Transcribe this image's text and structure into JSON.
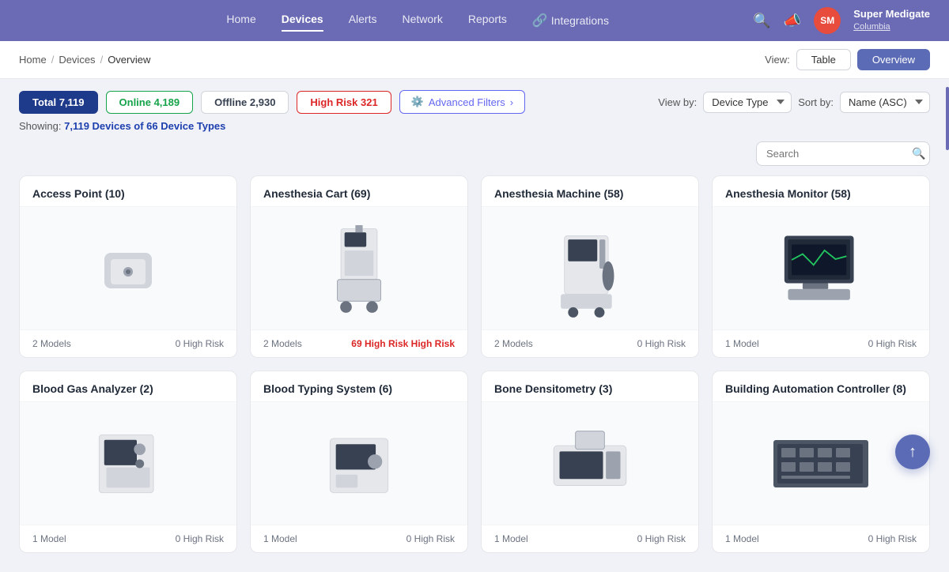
{
  "nav": {
    "links": [
      {
        "label": "Home",
        "active": false
      },
      {
        "label": "Devices",
        "active": true
      },
      {
        "label": "Alerts",
        "active": false
      },
      {
        "label": "Network",
        "active": false
      },
      {
        "label": "Reports",
        "active": false
      },
      {
        "label": "Integrations",
        "active": false
      }
    ],
    "user": {
      "name": "Super Medigate",
      "org": "Columbia",
      "initials": "SM"
    }
  },
  "breadcrumb": {
    "home": "Home",
    "devices": "Devices",
    "current": "Overview"
  },
  "view": {
    "label": "View:",
    "table_label": "Table",
    "overview_label": "Overview",
    "active": "Overview"
  },
  "filters": {
    "total_label": "Total 7,119",
    "online_label": "Online 4,189",
    "offline_label": "Offline 2,930",
    "high_risk_label": "High Risk 321",
    "adv_filters_label": "Advanced Filters",
    "viewby_label": "View by:",
    "viewby_option": "Device Type",
    "sortby_label": "Sort by:",
    "sortby_option": "Name (ASC)"
  },
  "showing": {
    "prefix": "Showing:",
    "highlight": "7,119 Devices of 66 Device Types"
  },
  "search": {
    "placeholder": "Search"
  },
  "devices": [
    {
      "name": "Access Point (10)",
      "models": "2 Models",
      "high_risk": "0 High Risk",
      "high_risk_count": 0,
      "image_type": "access_point"
    },
    {
      "name": "Anesthesia Cart (69)",
      "models": "2 Models",
      "high_risk": "69 High Risk",
      "high_risk_count": 69,
      "image_type": "anesthesia_cart"
    },
    {
      "name": "Anesthesia Machine (58)",
      "models": "2 Models",
      "high_risk": "0 High Risk",
      "high_risk_count": 0,
      "image_type": "anesthesia_machine"
    },
    {
      "name": "Anesthesia Monitor (58)",
      "models": "1 Model",
      "high_risk": "0 High Risk",
      "high_risk_count": 0,
      "image_type": "anesthesia_monitor"
    },
    {
      "name": "Blood Gas Analyzer (2)",
      "models": "1 Model",
      "high_risk": "0 High Risk",
      "high_risk_count": 0,
      "image_type": "blood_gas"
    },
    {
      "name": "Blood Typing System (6)",
      "models": "1 Model",
      "high_risk": "0 High Risk",
      "high_risk_count": 0,
      "image_type": "blood_typing"
    },
    {
      "name": "Bone Densitometry (3)",
      "models": "1 Model",
      "high_risk": "0 High Risk",
      "high_risk_count": 0,
      "image_type": "bone_density"
    },
    {
      "name": "Building Automation Controller (8)",
      "models": "1 Model",
      "high_risk": "0 High Risk",
      "high_risk_count": 0,
      "image_type": "building_auto"
    }
  ]
}
